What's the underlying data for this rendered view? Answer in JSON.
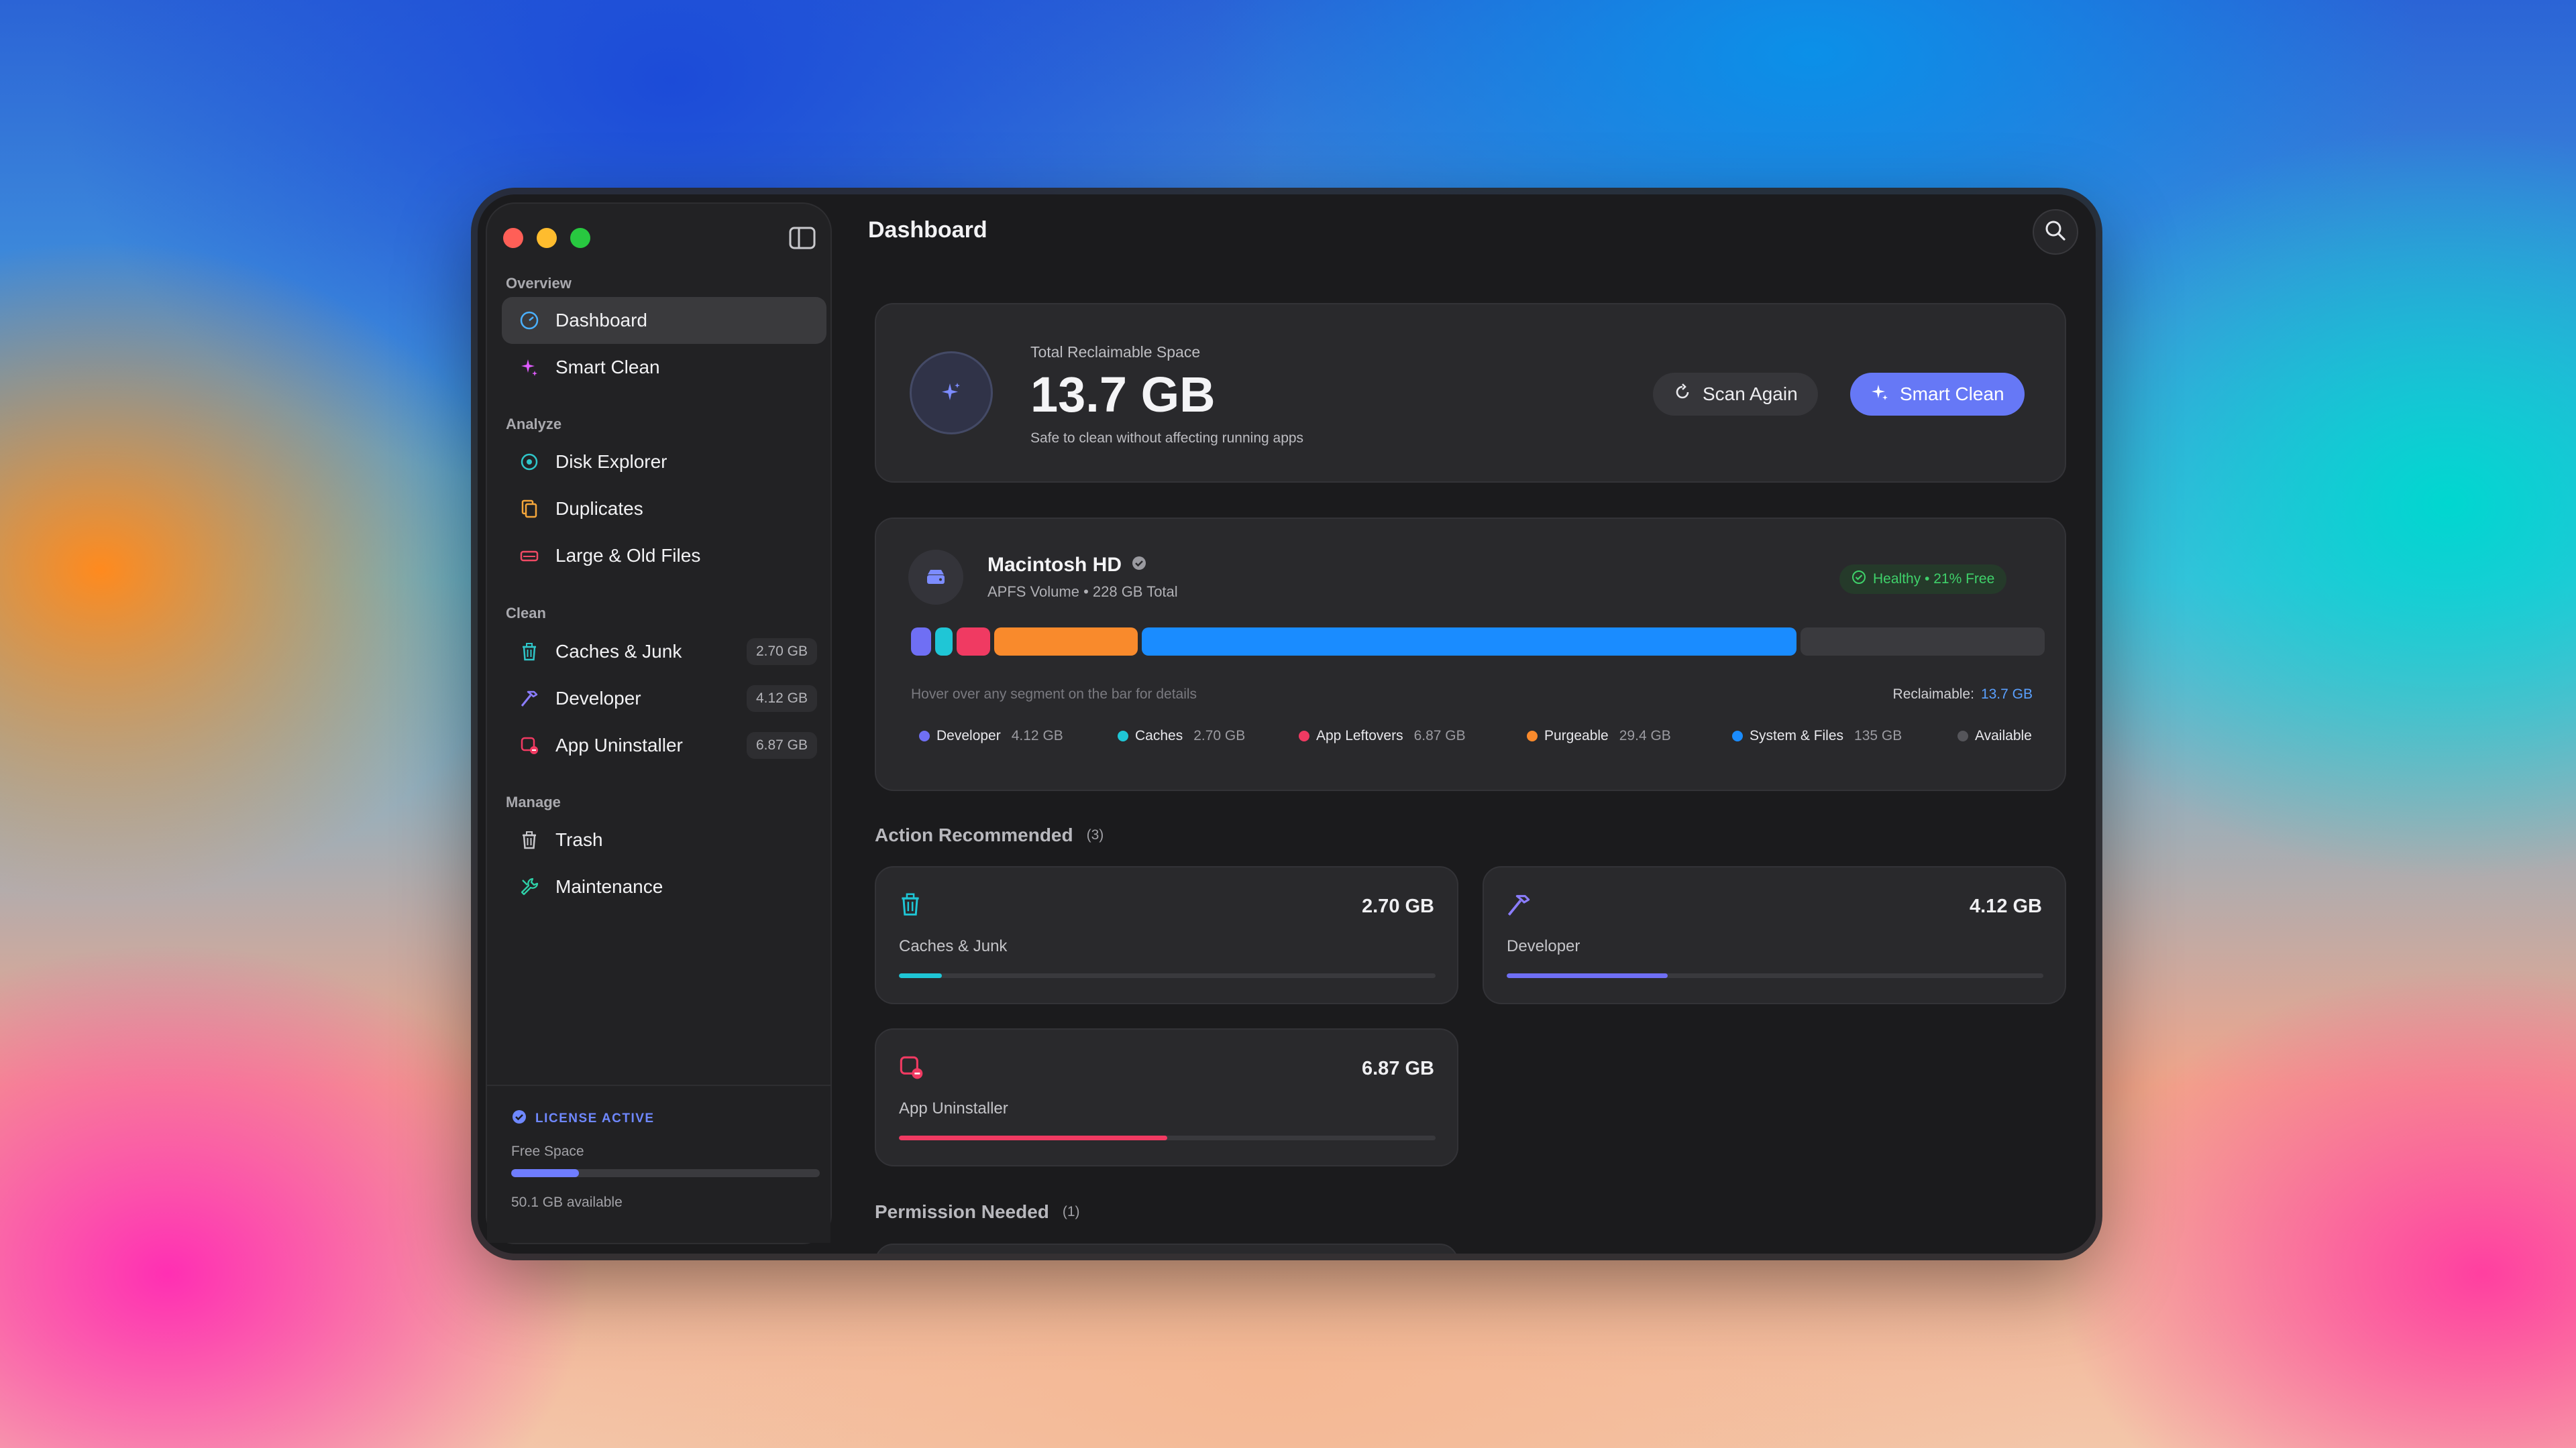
{
  "window": {
    "title": "Dashboard"
  },
  "colors": {
    "accent": "#6678f6",
    "developer": "#6f6ff4",
    "caches": "#1fc6d6",
    "app_leftovers": "#f03a62",
    "purgeable": "#f98a2c",
    "system": "#1a8cff",
    "available": "#3a3a3e",
    "healthy": "#3fd16a"
  },
  "sidebar": {
    "sections": [
      {
        "label": "Overview"
      },
      {
        "label": "Analyze"
      },
      {
        "label": "Clean"
      },
      {
        "label": "Manage"
      }
    ],
    "items": [
      {
        "label": "Dashboard",
        "icon": "gauge-icon",
        "active": true
      },
      {
        "label": "Smart Clean",
        "icon": "sparkle-icon"
      },
      {
        "label": "Disk Explorer",
        "icon": "target-icon"
      },
      {
        "label": "Duplicates",
        "icon": "duplicate-files-icon"
      },
      {
        "label": "Large & Old Files",
        "icon": "drive-icon"
      },
      {
        "label": "Caches & Junk",
        "icon": "trash-icon",
        "badge": "2.70 GB"
      },
      {
        "label": "Developer",
        "icon": "hammer-icon",
        "badge": "4.12 GB"
      },
      {
        "label": "App Uninstaller",
        "icon": "app-remove-icon",
        "badge": "6.87 GB"
      },
      {
        "label": "Trash",
        "icon": "trash-icon"
      },
      {
        "label": "Maintenance",
        "icon": "wrench-icon"
      }
    ],
    "license": {
      "status": "LICENSE ACTIVE",
      "free_label": "Free Space",
      "free_fraction": 0.22,
      "available": "50.1 GB available"
    }
  },
  "hero": {
    "subtitle": "Total Reclaimable Space",
    "value": "13.7 GB",
    "note": "Safe to clean without affecting running apps",
    "scan_label": "Scan Again",
    "smart_label": "Smart Clean"
  },
  "disk": {
    "name": "Macintosh HD",
    "subtitle": "APFS Volume • 228 GB Total",
    "health": "Healthy • 21% Free",
    "hover_hint": "Hover over any segment on the bar for details",
    "reclaim_label": "Reclaimable:",
    "reclaim_value": "13.7 GB",
    "segments": [
      {
        "name": "Developer",
        "value": "4.12 GB",
        "gb": 4.12,
        "color": "#6f6ff4"
      },
      {
        "name": "Caches",
        "value": "2.70 GB",
        "gb": 2.7,
        "color": "#1fc6d6"
      },
      {
        "name": "App Leftovers",
        "value": "6.87 GB",
        "gb": 6.87,
        "color": "#f03a62"
      },
      {
        "name": "Purgeable",
        "value": "29.4 GB",
        "gb": 29.4,
        "color": "#f98a2c"
      },
      {
        "name": "System & Files",
        "value": "135 GB",
        "gb": 135,
        "color": "#1a8cff"
      },
      {
        "name": "Available",
        "value": "",
        "gb": 50.1,
        "color": "#3a3a3e"
      }
    ]
  },
  "actions": {
    "heading": "Action Recommended",
    "count": "(3)",
    "cards": [
      {
        "name": "Caches & Junk",
        "value": "2.70 GB",
        "icon": "trash-icon",
        "fraction": 0.08,
        "color": "#1fc6d6"
      },
      {
        "name": "Developer",
        "value": "4.12 GB",
        "icon": "hammer-icon",
        "fraction": 0.3,
        "color": "#6f6ff4"
      },
      {
        "name": "App Uninstaller",
        "value": "6.87 GB",
        "icon": "app-remove-icon",
        "fraction": 0.5,
        "color": "#f03a62"
      }
    ]
  },
  "permission": {
    "heading": "Permission Needed",
    "count": "(1)"
  }
}
